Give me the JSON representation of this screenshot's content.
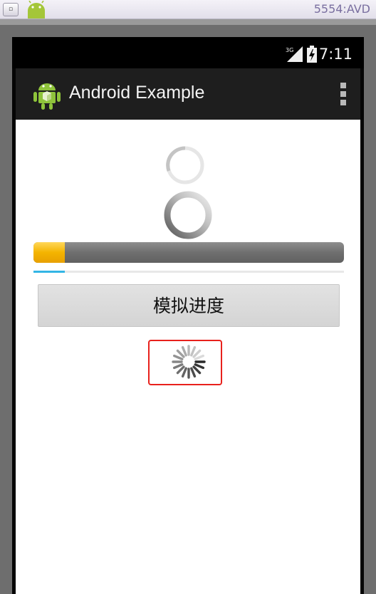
{
  "window": {
    "title": "5554:AVD",
    "icons": [
      "window-menu-icon",
      "android-robot-icon"
    ]
  },
  "statusbar": {
    "network_label": "3G",
    "time": "7:11",
    "icons": [
      "signal-icon",
      "battery-charging-icon"
    ]
  },
  "actionbar": {
    "title": "Android Example",
    "icons": [
      "app-launcher-icon",
      "overflow-menu-icon"
    ]
  },
  "content": {
    "progress_bar_value": 0.1,
    "secondary_progress_value": 0.1,
    "simulate_button_label": "模拟进度"
  },
  "colors": {
    "progress_fill": "#f4b400",
    "holo_progress": "#33b5e5",
    "highlight_border": "#e8211c",
    "actionbar_bg": "#1e1e1e"
  }
}
